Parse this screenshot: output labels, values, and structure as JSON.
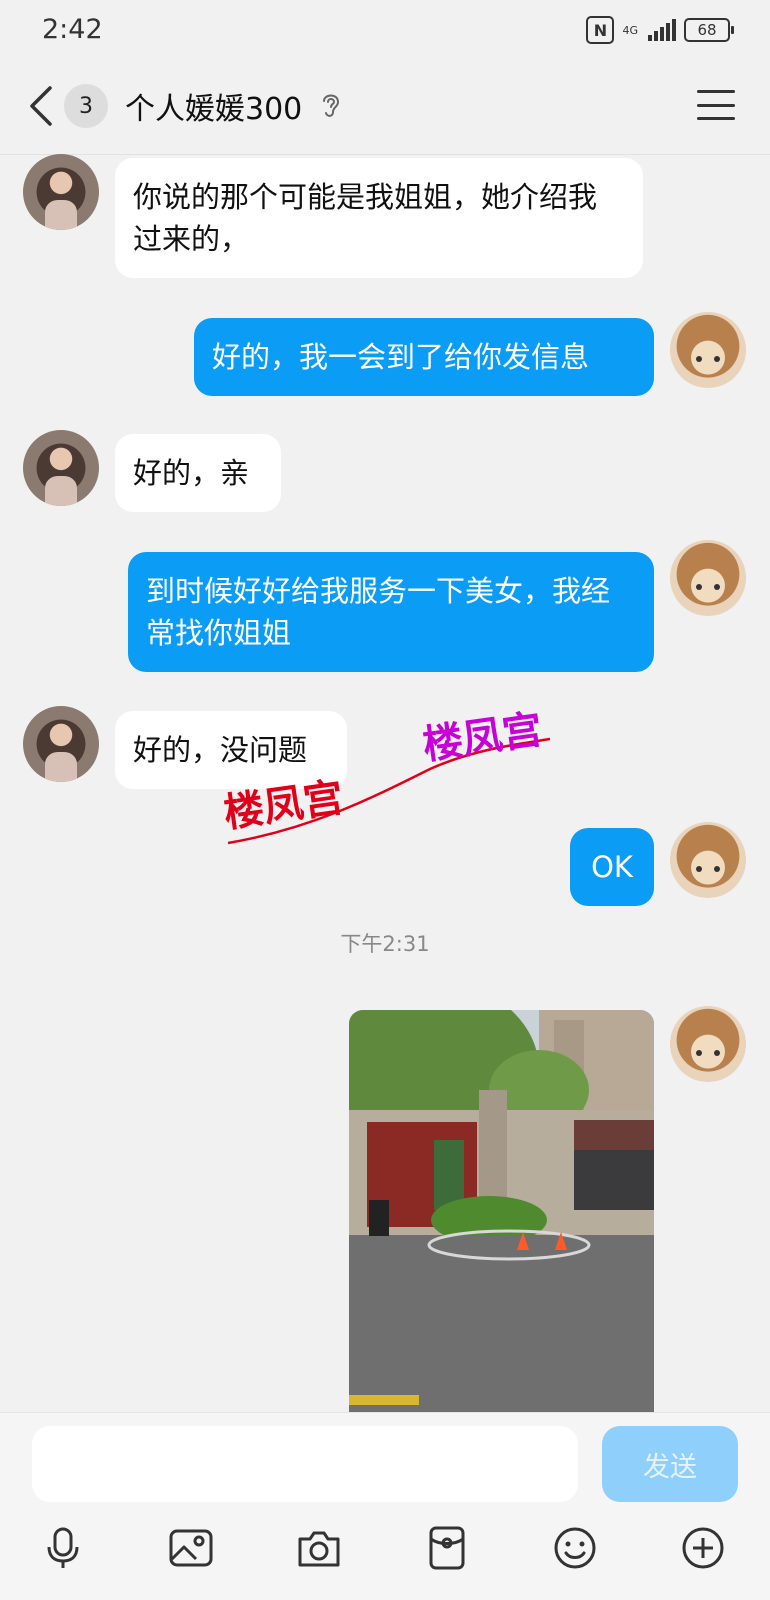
{
  "status_bar": {
    "time": "2:42",
    "network": "4G",
    "battery": "68"
  },
  "header": {
    "unread_count": "3",
    "title": "个人媛媛300"
  },
  "messages": [
    {
      "direction": "received",
      "text": "你说的那个可能是我姐姐，她介绍我过来的，"
    },
    {
      "direction": "sent",
      "text": "好的，我一会到了给你发信息"
    },
    {
      "direction": "received",
      "text": "好的，亲"
    },
    {
      "direction": "sent",
      "text": "到时候好好给我服务一下美女，我经常找你姐姐"
    },
    {
      "direction": "received",
      "text": "好的，没问题"
    },
    {
      "direction": "sent",
      "text": "OK"
    }
  ],
  "time_divider": "下午2:31",
  "watermark": {
    "text": "楼凤宫",
    "colors": [
      "#e0001a",
      "#c800d8"
    ]
  },
  "input": {
    "value": "",
    "send_label": "发送"
  },
  "toolbar": {
    "icons": [
      "microphone-icon",
      "image-icon",
      "camera-icon",
      "red-packet-icon",
      "emoji-icon",
      "plus-icon"
    ]
  },
  "colors": {
    "sent_bubble": "#0b9cf5",
    "received_bubble": "#ffffff",
    "send_button": "#8ecffb",
    "background": "#f1f1f1"
  }
}
